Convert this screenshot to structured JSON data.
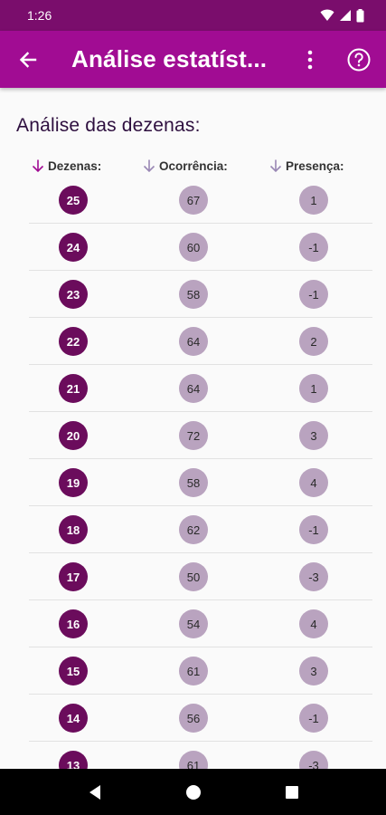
{
  "status_bar": {
    "time": "1:26"
  },
  "app_bar": {
    "title": "Análise estatíst..."
  },
  "section_title": "Análise das dezenas:",
  "columns": {
    "dezenas": "Dezenas:",
    "ocorrencia": "Ocorrência:",
    "presenca": "Presença:"
  },
  "colors": {
    "status_bar": "#7a0d6c",
    "app_bar": "#a10c93",
    "ball_primary": "#6b0c5c",
    "ball_secondary": "#b9a3bf",
    "sort_arrow_active": "#a10c93",
    "sort_arrow_inactive": "#9a88b5"
  },
  "rows": [
    {
      "dezena": "25",
      "ocorrencia": "67",
      "presenca": "1"
    },
    {
      "dezena": "24",
      "ocorrencia": "60",
      "presenca": "-1"
    },
    {
      "dezena": "23",
      "ocorrencia": "58",
      "presenca": "-1"
    },
    {
      "dezena": "22",
      "ocorrencia": "64",
      "presenca": "2"
    },
    {
      "dezena": "21",
      "ocorrencia": "64",
      "presenca": "1"
    },
    {
      "dezena": "20",
      "ocorrencia": "72",
      "presenca": "3"
    },
    {
      "dezena": "19",
      "ocorrencia": "58",
      "presenca": "4"
    },
    {
      "dezena": "18",
      "ocorrencia": "62",
      "presenca": "-1"
    },
    {
      "dezena": "17",
      "ocorrencia": "50",
      "presenca": "-3"
    },
    {
      "dezena": "16",
      "ocorrencia": "54",
      "presenca": "4"
    },
    {
      "dezena": "15",
      "ocorrencia": "61",
      "presenca": "3"
    },
    {
      "dezena": "14",
      "ocorrencia": "56",
      "presenca": "-1"
    },
    {
      "dezena": "13",
      "ocorrencia": "61",
      "presenca": "-3"
    }
  ]
}
